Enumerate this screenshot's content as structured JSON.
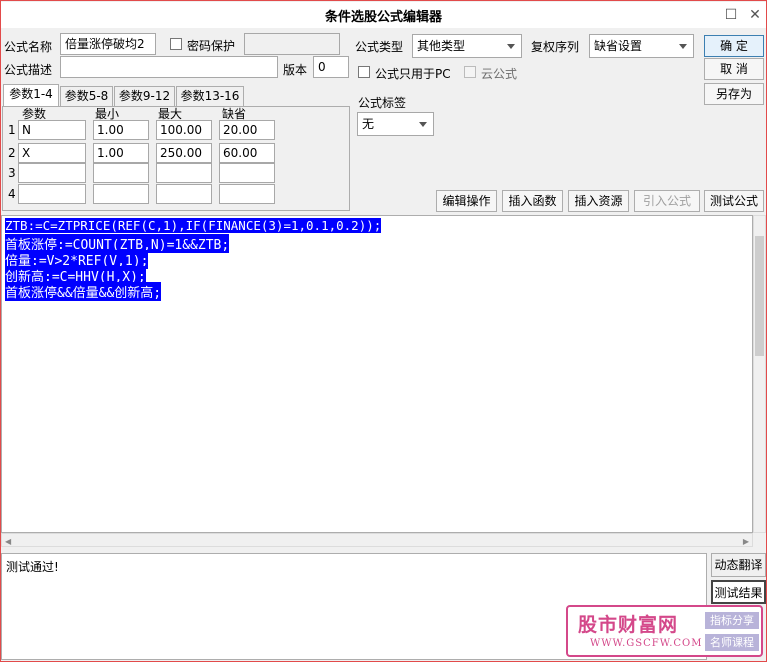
{
  "window": {
    "title": "条件选股公式编辑器",
    "controls": {
      "maximize": "☐",
      "close": "✕"
    }
  },
  "formula": {
    "name_label": "公式名称",
    "name_value": "倍量涨停破均2",
    "password_label": "密码保护",
    "desc_label": "公式描述",
    "desc_value": "",
    "version_label": "版本",
    "version_value": "0",
    "type_label": "公式类型",
    "type_value": "其他类型",
    "rights_label": "复权序列",
    "rights_value": "缺省设置",
    "pc_only_label": "公式只用于PC",
    "cloud_label": "云公式",
    "tag_label": "公式标签",
    "tag_value": "无"
  },
  "buttons": {
    "ok": "确  定",
    "cancel": "取  消",
    "save_as": "另存为",
    "edit_ops": "编辑操作",
    "insert_func": "插入函数",
    "insert_res": "插入资源",
    "import_formula": "引入公式",
    "test_formula": "测试公式",
    "dynamic_translate": "动态翻译",
    "test_result": "测试结果"
  },
  "param_tabs": [
    "参数1-4",
    "参数5-8",
    "参数9-12",
    "参数13-16"
  ],
  "param_table": {
    "headers": [
      "参数",
      "最小",
      "最大",
      "缺省"
    ],
    "rows": [
      {
        "idx": "1",
        "name": "N",
        "min": "1.00",
        "max": "100.00",
        "def": "20.00"
      },
      {
        "idx": "2",
        "name": "X",
        "min": "1.00",
        "max": "250.00",
        "def": "60.00"
      },
      {
        "idx": "3",
        "name": "",
        "min": "",
        "max": "",
        "def": ""
      },
      {
        "idx": "4",
        "name": "",
        "min": "",
        "max": "",
        "def": ""
      }
    ]
  },
  "code": [
    "ZTB:=C=ZTPRICE(REF(C,1),IF(FINANCE(3)=1,0.1,0.2));",
    "首板涨停:=COUNT(ZTB,N)=1&&ZTB;",
    "倍量:=V>2*REF(V,1);",
    "创新高:=C=HHV(H,X);",
    "首板涨停&&倍量&&创新高;"
  ],
  "output": {
    "text": "测试通过!"
  },
  "watermark": {
    "brand": "股市财富网",
    "tag1": "指标分享",
    "tag2": "名师课程",
    "url": "WWW.GSCFW.COM",
    "brand_color": "#d4488a"
  }
}
